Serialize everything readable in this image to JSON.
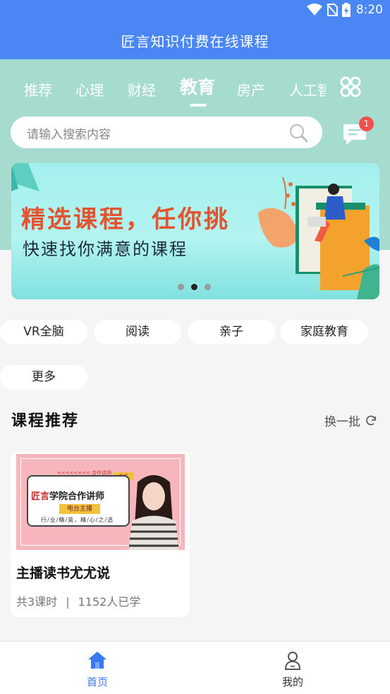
{
  "status_bar": {
    "time": "8:20"
  },
  "app": {
    "title": "匠言知识付费在线课程"
  },
  "tabs": [
    {
      "label": "推荐"
    },
    {
      "label": "心理"
    },
    {
      "label": "财经"
    },
    {
      "label": "教育",
      "active": true
    },
    {
      "label": "房产"
    },
    {
      "label": "人工智"
    }
  ],
  "search": {
    "placeholder": "请输入搜索内容"
  },
  "messages": {
    "badge_count": "1"
  },
  "banner": {
    "headline": "精选课程，任你挑",
    "subline": "快速找你满意的课程",
    "page_count": 3,
    "active_index": 1
  },
  "categories": [
    {
      "label": "VR全脑"
    },
    {
      "label": "阅读"
    },
    {
      "label": "亲子"
    },
    {
      "label": "家庭教育"
    },
    {
      "label": "更多"
    }
  ],
  "section": {
    "title": "课程推荐",
    "refresh_label": "换一批"
  },
  "courses": [
    {
      "title": "主播读书尤尤说",
      "lessons": "共3课时",
      "students": "1152人已学",
      "thumb": {
        "line1_red": "匠言",
        "line1_dark": "学院合作讲师",
        "badge": "电台主播",
        "tagline": "行/业/精/英，精/心/之/选",
        "tag": "<<<<<<<<  合作讲师",
        "name_tag": "尤尤"
      }
    }
  ],
  "bottom_nav": [
    {
      "label": "首页",
      "active": true
    },
    {
      "label": "我的",
      "active": false
    }
  ],
  "colors": {
    "brand_blue": "#4a86f4",
    "teal_bg": "#a6dccf",
    "banner_headline": "#e4522e",
    "badge_red": "#f24f4f"
  }
}
